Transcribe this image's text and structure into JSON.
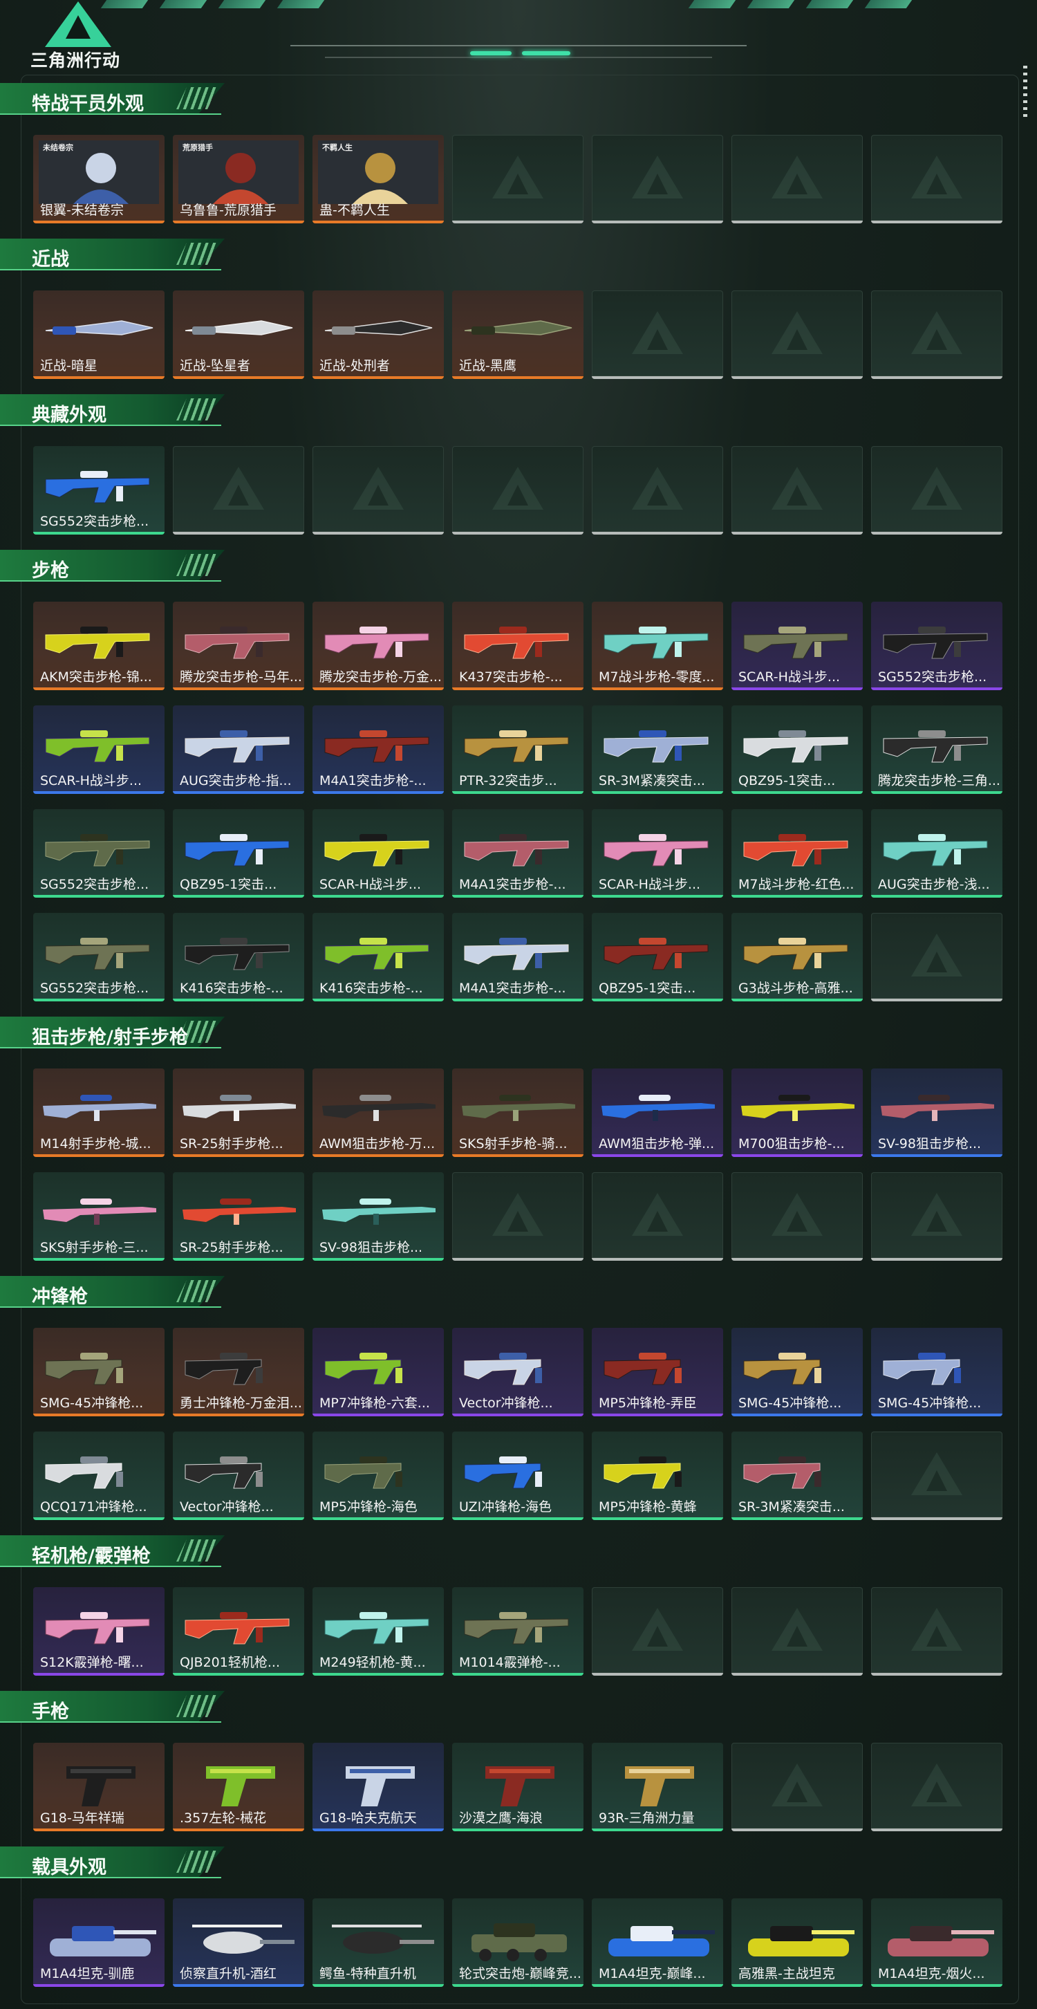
{
  "app": {
    "logo_text": "三角洲行动"
  },
  "sections": [
    {
      "title": "特战干员外观",
      "rows": [
        [
          {
            "label": "银翼-未结卷宗",
            "rarity": "orange",
            "icon": "operator-portrait",
            "badge": "未结卷宗"
          },
          {
            "label": "乌鲁鲁-荒原猎手",
            "rarity": "orange",
            "icon": "operator-portrait",
            "badge": "荒原猎手"
          },
          {
            "label": "蛊-不羁人生",
            "rarity": "orange",
            "icon": "operator-portrait",
            "badge": "不羁人生"
          },
          null,
          null,
          null,
          null
        ]
      ]
    },
    {
      "title": "近战",
      "rows": [
        [
          {
            "label": "近战-暗星",
            "rarity": "orange",
            "icon": "knife-icon"
          },
          {
            "label": "近战-坠星者",
            "rarity": "orange",
            "icon": "knife-icon"
          },
          {
            "label": "近战-处刑者",
            "rarity": "orange",
            "icon": "knife-icon"
          },
          {
            "label": "近战-黑鹰",
            "rarity": "orange",
            "icon": "knife-icon"
          },
          null,
          null,
          null
        ]
      ]
    },
    {
      "title": "典藏外观",
      "rows": [
        [
          {
            "label": "SG552突击步枪...",
            "rarity": "green",
            "icon": "rifle-icon"
          },
          null,
          null,
          null,
          null,
          null,
          null
        ]
      ]
    },
    {
      "title": "步枪",
      "rows": [
        [
          {
            "label": "AKM突击步枪-锦...",
            "rarity": "orange",
            "icon": "rifle-icon"
          },
          {
            "label": "腾龙突击步枪-马年...",
            "rarity": "orange",
            "icon": "rifle-icon"
          },
          {
            "label": "腾龙突击步枪-万金...",
            "rarity": "orange",
            "icon": "rifle-icon"
          },
          {
            "label": "K437突击步枪-...",
            "rarity": "orange",
            "icon": "rifle-icon"
          },
          {
            "label": "M7战斗步枪-零度...",
            "rarity": "orange",
            "icon": "rifle-icon"
          },
          {
            "label": "SCAR-H战斗步...",
            "rarity": "purple",
            "icon": "rifle-icon"
          },
          {
            "label": "SG552突击步枪...",
            "rarity": "purple",
            "icon": "rifle-icon"
          }
        ],
        [
          {
            "label": "SCAR-H战斗步...",
            "rarity": "blue",
            "icon": "rifle-icon"
          },
          {
            "label": "AUG突击步枪-指...",
            "rarity": "blue",
            "icon": "rifle-icon"
          },
          {
            "label": "M4A1突击步枪-...",
            "rarity": "blue",
            "icon": "rifle-icon"
          },
          {
            "label": "PTR-32突击步...",
            "rarity": "green",
            "icon": "rifle-icon"
          },
          {
            "label": "SR-3M紧凑突击...",
            "rarity": "green",
            "icon": "rifle-icon"
          },
          {
            "label": "QBZ95-1突击...",
            "rarity": "green",
            "icon": "rifle-icon"
          },
          {
            "label": "腾龙突击步枪-三角...",
            "rarity": "green",
            "icon": "rifle-icon"
          }
        ],
        [
          {
            "label": "SG552突击步枪...",
            "rarity": "green",
            "icon": "rifle-icon"
          },
          {
            "label": "QBZ95-1突击...",
            "rarity": "green",
            "icon": "rifle-icon"
          },
          {
            "label": "SCAR-H战斗步...",
            "rarity": "green",
            "icon": "rifle-icon"
          },
          {
            "label": "M4A1突击步枪-...",
            "rarity": "green",
            "icon": "rifle-icon"
          },
          {
            "label": "SCAR-H战斗步...",
            "rarity": "green",
            "icon": "rifle-icon"
          },
          {
            "label": "M7战斗步枪-红色...",
            "rarity": "green",
            "icon": "rifle-icon"
          },
          {
            "label": "AUG突击步枪-浅...",
            "rarity": "green",
            "icon": "rifle-icon"
          }
        ],
        [
          {
            "label": "SG552突击步枪...",
            "rarity": "green",
            "icon": "rifle-icon"
          },
          {
            "label": "K416突击步枪-...",
            "rarity": "green",
            "icon": "rifle-icon"
          },
          {
            "label": "K416突击步枪-...",
            "rarity": "green",
            "icon": "rifle-icon"
          },
          {
            "label": "M4A1突击步枪-...",
            "rarity": "green",
            "icon": "rifle-icon"
          },
          {
            "label": "QBZ95-1突击...",
            "rarity": "green",
            "icon": "rifle-icon"
          },
          {
            "label": "G3战斗步枪-高雅...",
            "rarity": "green",
            "icon": "rifle-icon"
          },
          null
        ]
      ]
    },
    {
      "title": "狙击步枪/射手步枪",
      "rows": [
        [
          {
            "label": "M14射手步枪-城...",
            "rarity": "orange",
            "icon": "sniper-icon"
          },
          {
            "label": "SR-25射手步枪...",
            "rarity": "orange",
            "icon": "sniper-icon"
          },
          {
            "label": "AWM狙击步枪-万...",
            "rarity": "orange",
            "icon": "sniper-icon"
          },
          {
            "label": "SKS射手步枪-骑...",
            "rarity": "orange",
            "icon": "sniper-icon"
          },
          {
            "label": "AWM狙击步枪-弹...",
            "rarity": "purple",
            "icon": "sniper-icon"
          },
          {
            "label": "M700狙击步枪-...",
            "rarity": "purple",
            "icon": "sniper-icon"
          },
          {
            "label": "SV-98狙击步枪...",
            "rarity": "blue",
            "icon": "sniper-icon"
          }
        ],
        [
          {
            "label": "SKS射手步枪-三...",
            "rarity": "green",
            "icon": "sniper-icon"
          },
          {
            "label": "SR-25射手步枪...",
            "rarity": "green",
            "icon": "sniper-icon"
          },
          {
            "label": "SV-98狙击步枪...",
            "rarity": "green",
            "icon": "sniper-icon"
          },
          null,
          null,
          null,
          null
        ]
      ]
    },
    {
      "title": "冲锋枪",
      "rows": [
        [
          {
            "label": "SMG-45冲锋枪...",
            "rarity": "orange",
            "icon": "smg-icon"
          },
          {
            "label": "勇士冲锋枪-万金泪...",
            "rarity": "orange",
            "icon": "smg-icon"
          },
          {
            "label": "MP7冲锋枪-六套...",
            "rarity": "purple",
            "icon": "smg-icon"
          },
          {
            "label": "Vector冲锋枪...",
            "rarity": "purple",
            "icon": "smg-icon"
          },
          {
            "label": "MP5冲锋枪-弄臣",
            "rarity": "purple",
            "icon": "smg-icon"
          },
          {
            "label": "SMG-45冲锋枪...",
            "rarity": "blue",
            "icon": "smg-icon"
          },
          {
            "label": "SMG-45冲锋枪...",
            "rarity": "blue",
            "icon": "smg-icon"
          }
        ],
        [
          {
            "label": "QCQ171冲锋枪...",
            "rarity": "green",
            "icon": "smg-icon"
          },
          {
            "label": "Vector冲锋枪...",
            "rarity": "green",
            "icon": "smg-icon"
          },
          {
            "label": "MP5冲锋枪-海色",
            "rarity": "green",
            "icon": "smg-icon"
          },
          {
            "label": "UZI冲锋枪-海色",
            "rarity": "green",
            "icon": "smg-icon"
          },
          {
            "label": "MP5冲锋枪-黄蜂",
            "rarity": "green",
            "icon": "smg-icon"
          },
          {
            "label": "SR-3M紧凑突击...",
            "rarity": "green",
            "icon": "smg-icon"
          },
          null
        ]
      ]
    },
    {
      "title": "轻机枪/霰弹枪",
      "rows": [
        [
          {
            "label": "S12K霰弹枪-曙...",
            "rarity": "purple",
            "icon": "shotgun-icon"
          },
          {
            "label": "QJB201轻机枪...",
            "rarity": "green",
            "icon": "lmg-icon"
          },
          {
            "label": "M249轻机枪-黄...",
            "rarity": "green",
            "icon": "lmg-icon"
          },
          {
            "label": "M1014霰弹枪-...",
            "rarity": "green",
            "icon": "shotgun-icon"
          },
          null,
          null,
          null
        ]
      ]
    },
    {
      "title": "手枪",
      "rows": [
        [
          {
            "label": "G18-马年祥瑞",
            "rarity": "orange",
            "icon": "pistol-icon"
          },
          {
            "label": ".357左轮-械花",
            "rarity": "orange",
            "icon": "pistol-icon"
          },
          {
            "label": "G18-哈夫克航天",
            "rarity": "blue",
            "icon": "pistol-icon"
          },
          {
            "label": "沙漠之鹰-海浪",
            "rarity": "green",
            "icon": "pistol-icon"
          },
          {
            "label": "93R-三角洲力量",
            "rarity": "green",
            "icon": "pistol-icon"
          },
          null,
          null
        ]
      ]
    },
    {
      "title": "载具外观",
      "rows": [
        [
          {
            "label": "M1A4坦克-驯鹿",
            "rarity": "purple",
            "icon": "tank-icon"
          },
          {
            "label": "侦察直升机-酒红",
            "rarity": "blue",
            "icon": "helicopter-icon"
          },
          {
            "label": "鳄鱼-特种直升机",
            "rarity": "green",
            "icon": "helicopter-icon"
          },
          {
            "label": "轮式突击炮-巅峰竞...",
            "rarity": "green",
            "icon": "vehicle-icon"
          },
          {
            "label": "M1A4坦克-巅峰...",
            "rarity": "green",
            "icon": "tank-icon"
          },
          {
            "label": "高雅黑-主战坦克",
            "rarity": "green",
            "icon": "tank-icon"
          },
          {
            "label": "M1A4坦克-烟火...",
            "rarity": "green",
            "icon": "tank-icon"
          }
        ]
      ]
    }
  ],
  "colors": {
    "orange": "#e77a28",
    "purple": "#8a47e8",
    "blue": "#3c78ea",
    "green": "#3dd88e",
    "empty": "#b7bcba",
    "accent": "#37d19a"
  }
}
